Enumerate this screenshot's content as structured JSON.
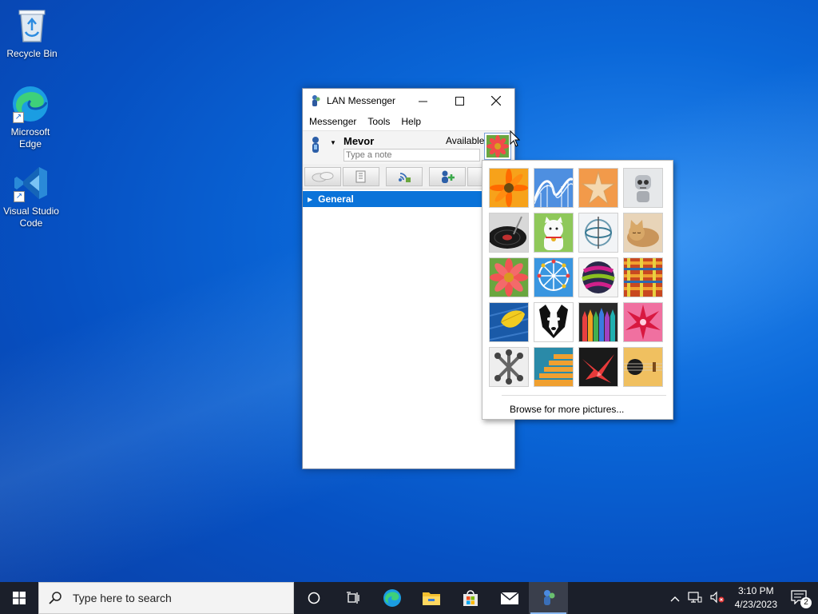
{
  "desktop": {
    "icons": [
      {
        "label": "Recycle Bin"
      },
      {
        "label": "Microsoft Edge"
      },
      {
        "label": "Visual Studio Code"
      }
    ]
  },
  "window": {
    "title": "LAN Messenger",
    "menu": [
      "Messenger",
      "Tools",
      "Help"
    ],
    "user": {
      "name": "Mevor",
      "status": "Available",
      "note_placeholder": "Type a note"
    },
    "groups": [
      {
        "name": "General"
      }
    ]
  },
  "picture_menu": {
    "pictures": [
      "orange-gerbera",
      "roller-coaster",
      "starfish",
      "robot-toy",
      "vinyl-record",
      "lucky-cat",
      "gyroscope",
      "kitten",
      "pink-daisy",
      "ferris-wheel",
      "striped-ball",
      "woven-fabric",
      "yellow-leaf",
      "border-collie",
      "crayons",
      "red-star-lantern",
      "jacks",
      "stairs",
      "paper-crane",
      "guitar"
    ],
    "browse_label": "Browse for more pictures..."
  },
  "taskbar": {
    "search_placeholder": "Type here to search",
    "apps": [
      "task-view",
      "microsoft-edge",
      "file-explorer",
      "microsoft-store",
      "mail",
      "lan-messenger"
    ],
    "clock": {
      "time": "3:10 PM",
      "date": "4/23/2023"
    },
    "notification_count": "2"
  },
  "colors": {
    "accent": "#0a73d9",
    "desktop": "#0a67d8",
    "taskbar": "#1b1f2a"
  }
}
